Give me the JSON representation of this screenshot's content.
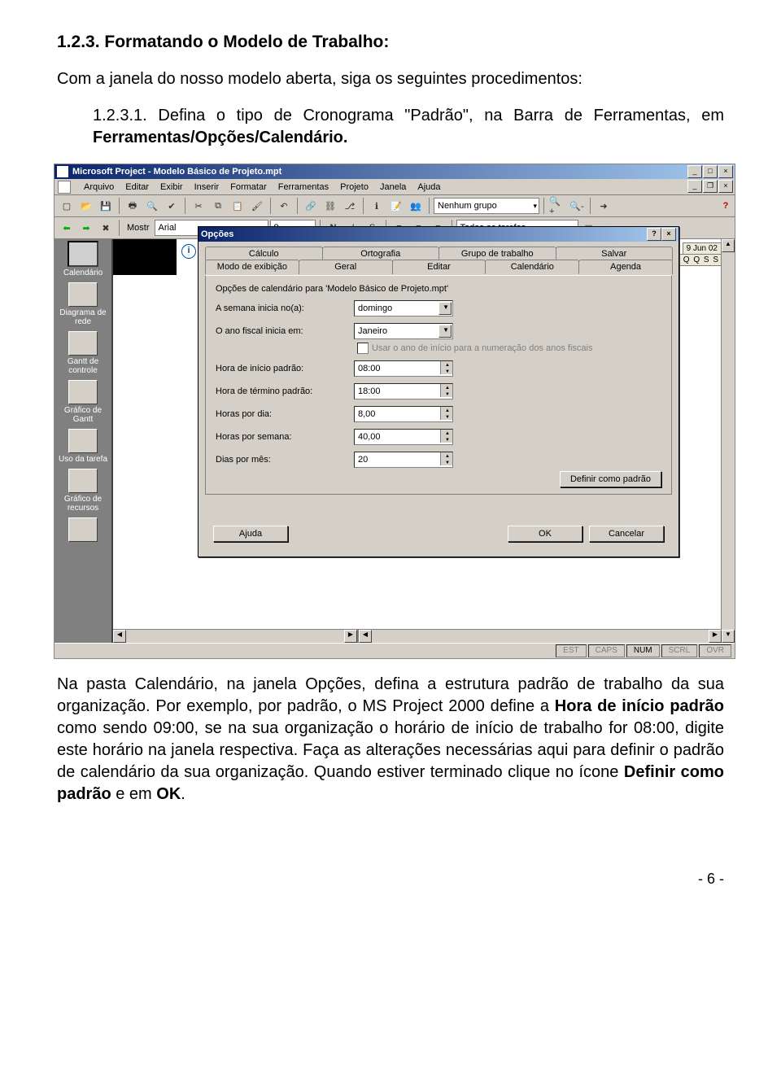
{
  "doc": {
    "section_title": "1.2.3. Formatando o Modelo de Trabalho:",
    "intro": "Com a janela do nosso modelo aberta, siga os seguintes procedimentos:",
    "step1_prefix": "1.2.3.1. Defina o tipo de Cronograma \"Padrão\", na Barra de Ferramentas, em ",
    "step1_bold": "Ferramentas/Opções/Calendário.",
    "body1": "Na pasta Calendário, na janela Opções, defina a estrutura padrão de trabalho da sua organização. Por exemplo, por padrão, o MS Project 2000 define a ",
    "body1_b1": "Hora de início padrão",
    "body1_2": " como sendo 09:00, se na sua organização o horário de início de trabalho for 08:00, digite este horário na janela respectiva. Faça as alterações necessárias aqui para definir o padrão de calendário da sua organização. Quando estiver terminado clique no ícone ",
    "body1_b2": "Definir como padrão",
    "body1_3": " e em ",
    "body1_b3": "OK",
    "body1_4": ".",
    "page_num": "- 6 -"
  },
  "app": {
    "title": "Microsoft Project - Modelo Básico de Projeto.mpt",
    "menus": [
      "Arquivo",
      "Editar",
      "Exibir",
      "Inserir",
      "Formatar",
      "Ferramentas",
      "Projeto",
      "Janela",
      "Ajuda"
    ],
    "group_combo": "Nenhum grupo",
    "font_combo": "Arial",
    "size_combo": "8",
    "filter_combo": "Todas as tarefas",
    "viewbar": [
      {
        "label": "Calendário"
      },
      {
        "label": "Diagrama de rede"
      },
      {
        "label": "Gantt de controle"
      },
      {
        "label": "Gráfico de Gantt"
      },
      {
        "label": "Uso da tarefa"
      },
      {
        "label": "Gráfico de recursos"
      }
    ],
    "date_header": "9 Jun 02",
    "day_letters": "S D S T Q Q S S",
    "status": [
      "EST",
      "CAPS",
      "NUM",
      "SCRL",
      "OVR"
    ]
  },
  "dialog": {
    "title": "Opções",
    "tabs_row1": [
      "Cálculo",
      "Ortografia",
      "Grupo de trabalho",
      "Salvar"
    ],
    "tabs_row2": [
      "Modo de exibição",
      "Geral",
      "Editar",
      "Calendário",
      "Agenda"
    ],
    "active_tab": "Calendário",
    "group": "Opções de calendário para 'Modelo Básico de Projeto.mpt'",
    "fields": {
      "week_start_label": "A semana inicia no(a):",
      "week_start_value": "domingo",
      "fy_start_label": "O ano fiscal inicia em:",
      "fy_start_value": "Janeiro",
      "fy_checkbox": "Usar o ano de início para a numeração dos anos fiscais",
      "start_time_label": "Hora de início padrão:",
      "start_time_value": "08:00",
      "end_time_label": "Hora de término padrão:",
      "end_time_value": "18:00",
      "hpd_label": "Horas por dia:",
      "hpd_value": "8,00",
      "hpw_label": "Horas por semana:",
      "hpw_value": "40,00",
      "dpm_label": "Dias por mês:",
      "dpm_value": "20"
    },
    "define_btn": "Definir como padrão",
    "help_btn": "Ajuda",
    "ok_btn": "OK",
    "cancel_btn": "Cancelar"
  }
}
